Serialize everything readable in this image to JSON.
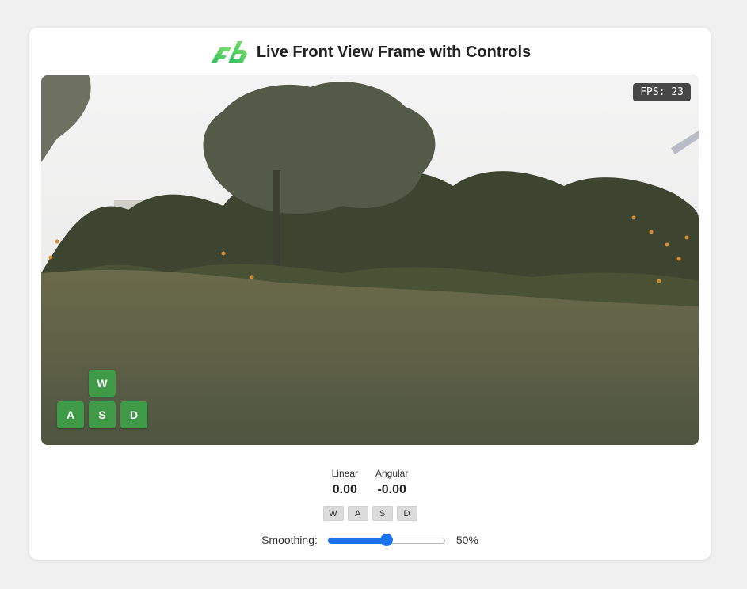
{
  "header": {
    "title": "Live Front View Frame with Controls",
    "logo_icon": "rb-logo-icon",
    "logo_color": "#3ecf6a"
  },
  "video": {
    "fps_label": "FPS:",
    "fps_value": "23",
    "overlay_keys": {
      "up": "W",
      "left": "A",
      "down": "S",
      "right": "D"
    },
    "key_color": "#3f9a48"
  },
  "telemetry": {
    "linear_label": "Linear",
    "linear_value": "0.00",
    "angular_label": "Angular",
    "angular_value": "-0.00"
  },
  "keys": [
    "W",
    "A",
    "S",
    "D"
  ],
  "smoothing": {
    "label": "Smoothing:",
    "value": 50,
    "value_text": "50%",
    "accent": "#1a73e8"
  }
}
